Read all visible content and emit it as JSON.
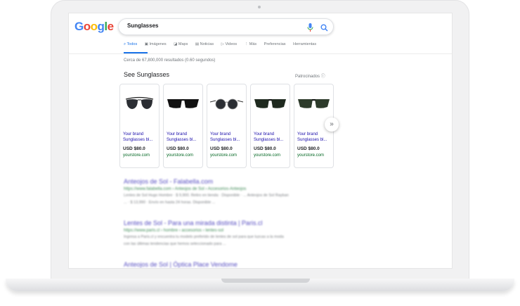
{
  "google": {
    "logo_letters": [
      "G",
      "o",
      "o",
      "g",
      "l",
      "e"
    ],
    "logo_colors": [
      "#4285F4",
      "#EA4335",
      "#FBBC05",
      "#4285F4",
      "#34A853",
      "#EA4335"
    ]
  },
  "search": {
    "query": "Sunglasses"
  },
  "tabs": [
    {
      "label": "Todos",
      "icon": "search-icon"
    },
    {
      "label": "Imágenes",
      "icon": "image-icon"
    },
    {
      "label": "Maps",
      "icon": "map-icon"
    },
    {
      "label": "Noticias",
      "icon": "news-icon"
    },
    {
      "label": "Videos",
      "icon": "video-icon"
    },
    {
      "label": "Más",
      "icon": "more-icon"
    },
    {
      "label": "Preferencias",
      "icon": ""
    },
    {
      "label": "Herramientas",
      "icon": ""
    }
  ],
  "results_stats": "Cerca de 67,800,000 resultados (0.60 segundos)",
  "shopping": {
    "heading": "See Sunglasses",
    "sponsored": "Patrocinados",
    "products": [
      {
        "title": "Your brand Sunglasses bl...",
        "price": "USD $80.0",
        "store": "yourstore.com",
        "icon": "aviator-sunglasses-icon"
      },
      {
        "title": "Your brand Sunglasses bl...",
        "price": "USD $80.0",
        "store": "yourstore.com",
        "icon": "wayfarer-sunglasses-icon"
      },
      {
        "title": "Your brand Sunglasses bl...",
        "price": "USD $80.0",
        "store": "yourstore.com",
        "icon": "round-sunglasses-icon"
      },
      {
        "title": "Your brand Sunglasses bl...",
        "price": "USD $80.0",
        "store": "yourstore.com",
        "icon": "wayfarer-sunglasses-icon"
      },
      {
        "title": "Your brand Sunglasses bl...",
        "price": "USD $80.0",
        "store": "yourstore.com",
        "icon": "wayfarer-sunglasses-icon"
      }
    ],
    "next_label": "»"
  },
  "organic": [
    {
      "title": "Anteojos de Sol - Falabella.com",
      "url": "https://www.falabella.com › Anteojos de Sol › Accesorios-Anteojos",
      "snippet1": "Lentes de Sol Hugo Hombre · $ 9,900. Retiro en tienda · Disponible · ... Anteojos de Sol Rayban",
      "snippet2": "... · $ 13,990 · Envío en hasta 24 horas. Disponible ..."
    },
    {
      "title": "Lentes de Sol - Para una mirada distinta | Paris.cl",
      "url": "https://www.paris.cl › hombre › accesorios › lentes-sol",
      "snippet1": "Ingresa a Paris.cl y encuentra tu modelo preferido de lentes de sol para que luzcas a la moda",
      "snippet2": "con las últimas tendencias que hemos seleccionado para ..."
    },
    {
      "title": "Anteojos de Sol | Óptica Place Vendome",
      "url": "",
      "snippet1": "",
      "snippet2": ""
    }
  ]
}
